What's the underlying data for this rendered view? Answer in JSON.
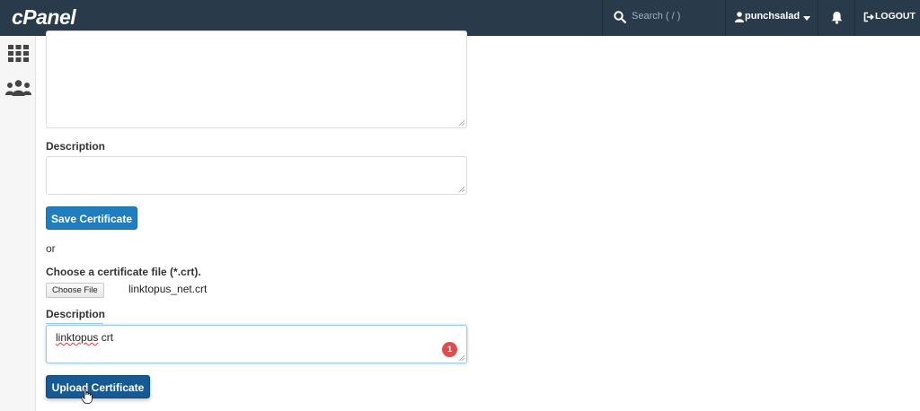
{
  "topbar": {
    "logo": "cPanel",
    "search_placeholder": "Search ( / )",
    "username": "punchsalad",
    "logout_label": "LOGOUT"
  },
  "form": {
    "description_label_1": "Description",
    "save_button": "Save Certificate",
    "or_text": "or",
    "choose_file_label": "Choose a certificate file (*.crt).",
    "choose_file_button": "Choose File",
    "chosen_file_name": "linktopus_net.crt",
    "description_label_2": "Description",
    "description_value_word1": "linktopus",
    "description_value_word2": " crt",
    "badge_count": "1",
    "upload_button": "Upload Certificate"
  },
  "colors": {
    "topbar_bg": "#293a4a",
    "primary_button": "#1f7ec2",
    "badge": "#e24b4b"
  }
}
